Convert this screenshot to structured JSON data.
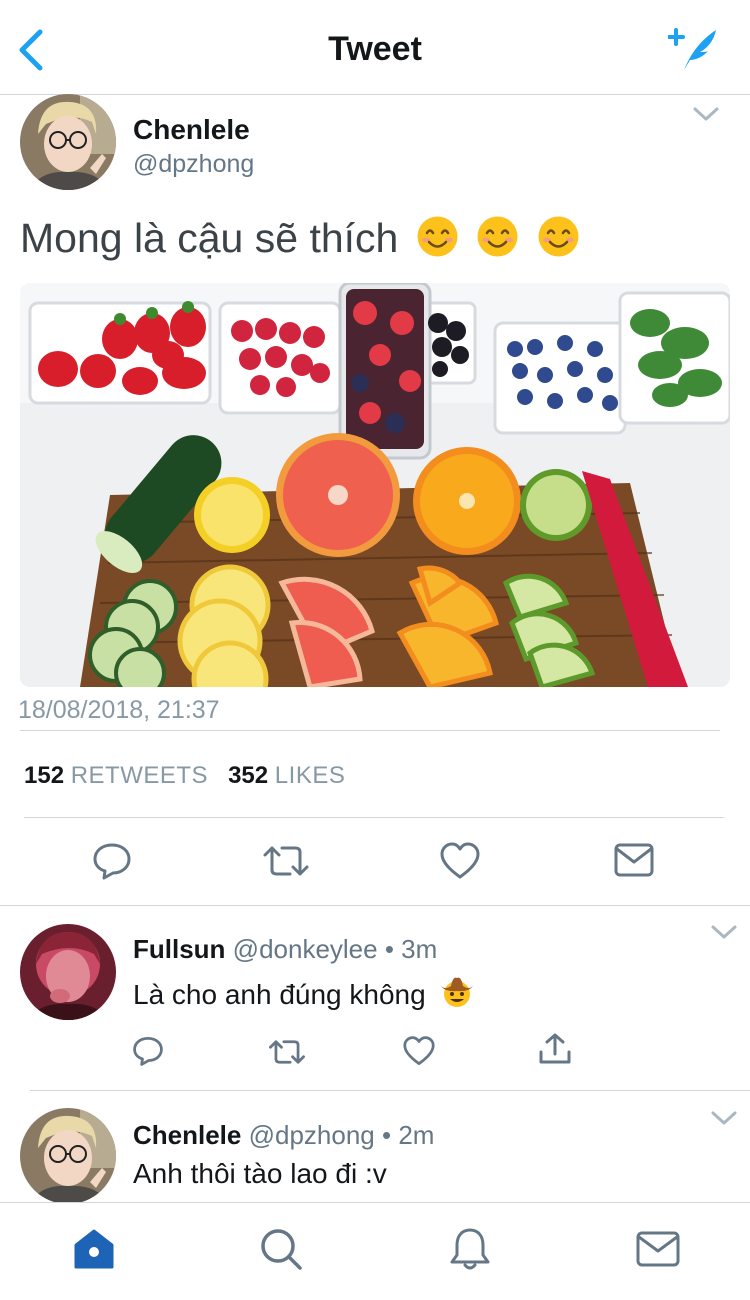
{
  "header": {
    "title": "Tweet"
  },
  "tweet": {
    "name": "Chenlele",
    "handle": "@dpzhong",
    "text": "Mong là cậu sẽ thích",
    "timestamp": "18/08/2018, 21:37",
    "retweets_count": "152",
    "retweets_label": "RETWEETS",
    "likes_count": "352",
    "likes_label": "LIKES"
  },
  "replies": [
    {
      "name": "Fullsun",
      "meta": "@donkeylee • 3m",
      "text": "Là cho anh đúng không"
    },
    {
      "name": "Chenlele",
      "meta": "@dpzhong • 2m",
      "text": "Anh thôi tào lao đi :v"
    }
  ],
  "colors": {
    "accent": "#1da1f2",
    "tab_active": "#1d63b6",
    "icon": "#657786"
  },
  "icons": [
    "back-icon",
    "compose-icon",
    "chevron-down-icon",
    "reply-icon",
    "retweet-icon",
    "like-icon",
    "dm-icon",
    "share-icon",
    "home-icon",
    "search-icon",
    "bell-icon",
    "mail-icon"
  ]
}
